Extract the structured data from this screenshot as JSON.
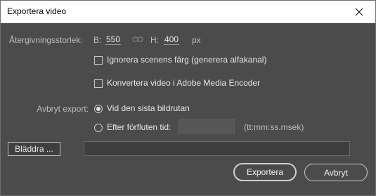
{
  "window": {
    "title": "Exportera video"
  },
  "size": {
    "label": "Återgivningsstorlek:",
    "width_prefix": "B:",
    "width_value": "550",
    "height_prefix": "H:",
    "height_value": "400",
    "unit": "px",
    "link_icon": "chain-link-icon"
  },
  "options": {
    "ignore_stage_color": {
      "label": "Ignorera scenens färg (generera alfakanal)",
      "checked": false
    },
    "convert_media_encoder": {
      "label": "Konvertera video i Adobe Media Encoder",
      "checked": false
    }
  },
  "stop_export": {
    "label": "Avbryt export:",
    "last_frame": {
      "label": "Vid den sista bildrutan",
      "selected": true
    },
    "elapsed_time": {
      "label": "Efter förfluten tid:",
      "selected": false,
      "value": "",
      "format_hint": "(tt:mm:ss.msek)"
    }
  },
  "browse": {
    "button_label": "Bläddra ...",
    "path_value": ""
  },
  "buttons": {
    "export_label": "Exportera",
    "cancel_label": "Avbryt"
  }
}
